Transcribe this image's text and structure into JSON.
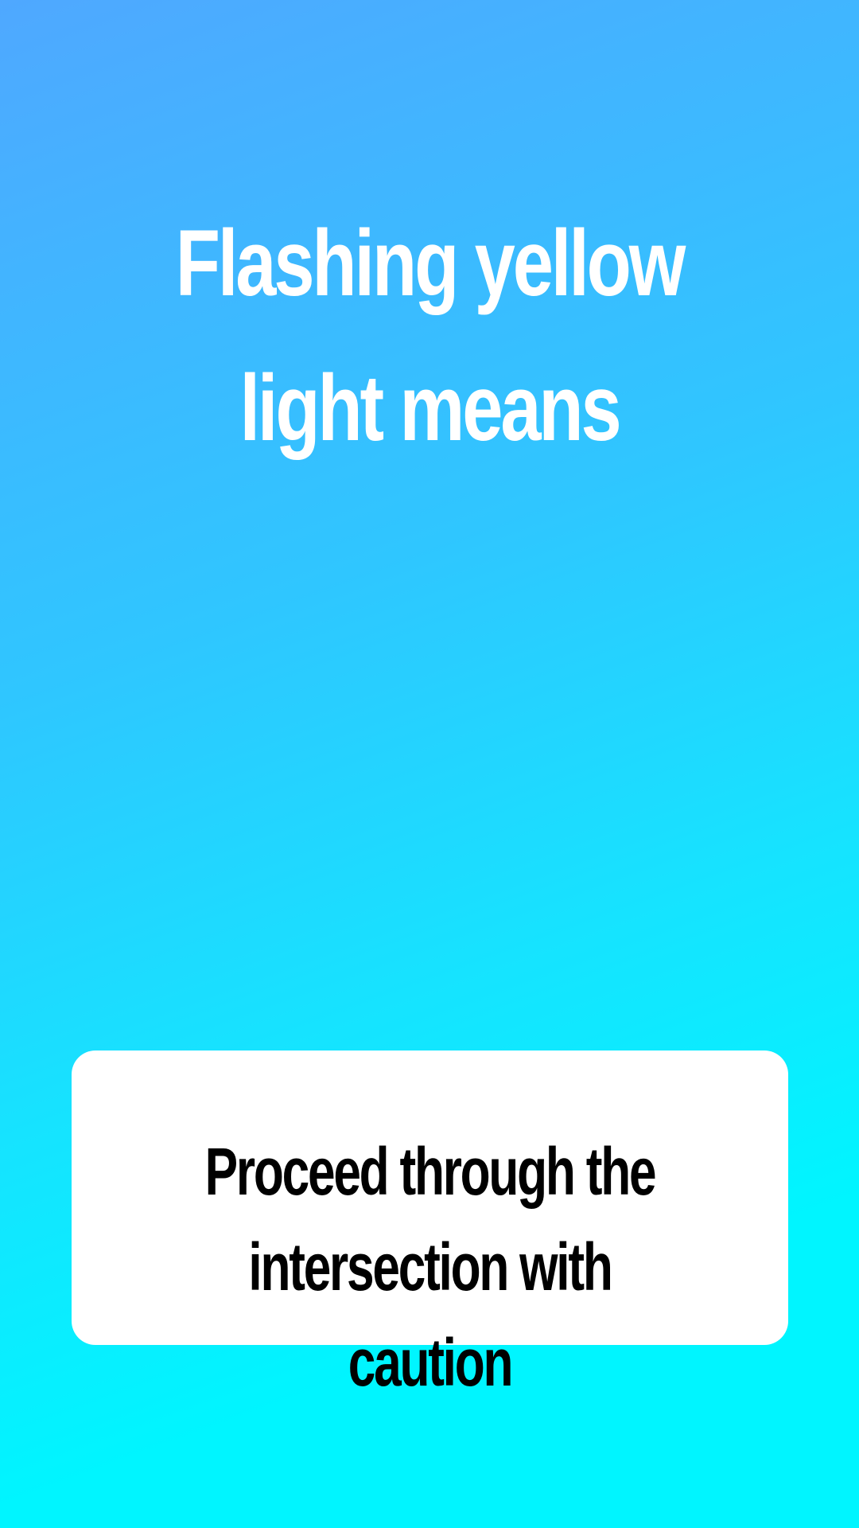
{
  "card": {
    "question": "Flashing yellow light means",
    "answer": "Proceed through the intersection with caution"
  },
  "colors": {
    "gradient_top": "#4fa8ff",
    "gradient_bottom": "#00f5ff",
    "question_text": "#ffffff",
    "answer_card_bg": "#ffffff",
    "answer_text": "#000000"
  }
}
